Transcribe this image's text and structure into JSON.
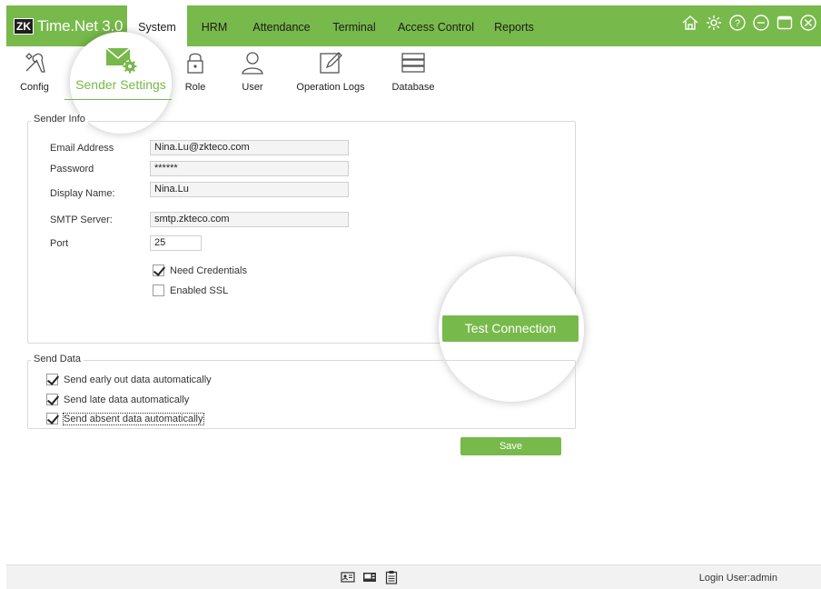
{
  "app": {
    "logo_mark": "ZK",
    "title": "Time.Net 3.0"
  },
  "nav": {
    "tabs": [
      {
        "label": "System",
        "active": true
      },
      {
        "label": "HRM"
      },
      {
        "label": "Attendance"
      },
      {
        "label": "Terminal"
      },
      {
        "label": "Access Control"
      },
      {
        "label": "Reports"
      }
    ],
    "icons": [
      "home-icon",
      "gear-icon",
      "help-icon",
      "minimize-icon",
      "maximize-icon",
      "close-icon"
    ]
  },
  "toolbar": {
    "items": [
      {
        "label": "Config",
        "icon": "tools-icon"
      },
      {
        "label": "Sender Settings",
        "icon": "mail-gear-icon",
        "active": true
      },
      {
        "label": "Role",
        "icon": "lock-icon"
      },
      {
        "label": "User",
        "icon": "user-icon"
      },
      {
        "label": "Operation Logs",
        "icon": "edit-log-icon"
      },
      {
        "label": "Database",
        "icon": "database-icon"
      }
    ]
  },
  "sender_info": {
    "title": "Sender Info",
    "email_label": "Email Address",
    "email_value": "Nina.Lu@zkteco.com",
    "password_label": "Password",
    "password_value": "******",
    "display_name_label": "Display Name:",
    "display_name_value": "Nina.Lu",
    "smtp_label": "SMTP Server:",
    "smtp_value": "smtp.zkteco.com",
    "port_label": "Port",
    "port_value": "25",
    "need_credentials_label": "Need Credentials",
    "need_credentials_checked": true,
    "ssl_label": "Enabled SSL",
    "ssl_checked": false,
    "test_button": "Test Connection"
  },
  "send_data": {
    "title": "Send Data",
    "options": [
      {
        "label": "Send early out data automatically",
        "checked": true
      },
      {
        "label": "Send late data automatically",
        "checked": true
      },
      {
        "label": "Send absent data automatically",
        "checked": true
      }
    ],
    "save_button": "Save"
  },
  "footer": {
    "icons": [
      "id-card-icon",
      "terminal-device-icon",
      "clipboard-icon"
    ],
    "login_text": "Login User:admin"
  },
  "colors": {
    "accent": "#77b94a"
  }
}
